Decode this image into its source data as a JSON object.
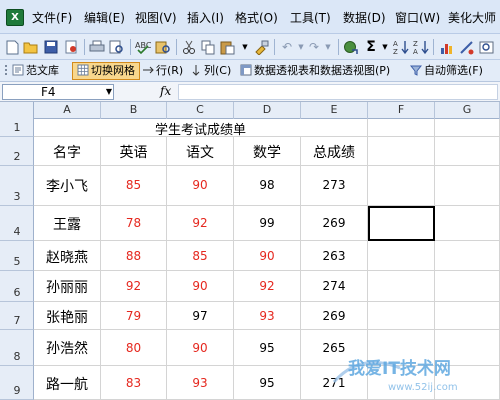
{
  "menubar": {
    "items": [
      "文件(F)",
      "编辑(E)",
      "视图(V)",
      "插入(I)",
      "格式(O)",
      "工具(T)",
      "数据(D)",
      "窗口(W)",
      "美化大师"
    ]
  },
  "toolbar1": {
    "icons": [
      "new-icon",
      "open-icon",
      "save-icon",
      "permission-icon",
      "print-icon",
      "print-preview-icon",
      "spell-check-icon",
      "research-icon",
      "cut-icon",
      "copy-icon",
      "paste-icon",
      "format-painter-icon",
      "undo-icon",
      "redo-icon",
      "hyperlink-icon",
      "autosum-icon",
      "sort-ascending-icon",
      "chart-icon"
    ],
    "sigma": "Σ"
  },
  "toolbar2": {
    "fanwenku": "范文库",
    "switch_grid": "切换网格",
    "row": "行(R)",
    "col": "列(C)",
    "pivot": "数据透视表和数据透视图(P)",
    "autofilter": "自动筛选(F)"
  },
  "formulabar": {
    "namebox": "F4",
    "fx": "fx",
    "formula": ""
  },
  "columns": [
    "A",
    "B",
    "C",
    "D",
    "E",
    "F",
    "G"
  ],
  "rows": [
    "1",
    "2",
    "3",
    "4",
    "5",
    "6",
    "7",
    "8",
    "9"
  ],
  "sheet": {
    "title": "学生考试成绩单",
    "headers": [
      "名字",
      "英语",
      "语文",
      "数学",
      "总成绩"
    ],
    "records": [
      {
        "name": "李小飞",
        "english": "85",
        "chinese": "90",
        "math": "98",
        "total": "273"
      },
      {
        "name": "王露",
        "english": "78",
        "chinese": "92",
        "math": "99",
        "total": "269"
      },
      {
        "name": "赵晓燕",
        "english": "88",
        "chinese": "85",
        "math": "90",
        "total": "263"
      },
      {
        "name": "孙丽丽",
        "english": "92",
        "chinese": "90",
        "math": "92",
        "total": "274"
      },
      {
        "name": "张艳丽",
        "english": "79",
        "chinese": "97",
        "math": "93",
        "total": "269"
      },
      {
        "name": "孙浩然",
        "english": "80",
        "chinese": "90",
        "math": "95",
        "total": "265"
      },
      {
        "name": "路一航",
        "english": "83",
        "chinese": "93",
        "math": "95",
        "total": "271"
      }
    ]
  },
  "colors": {
    "highlight_red": "#e5271e",
    "menubar_bg": "#dbe7f7",
    "header_bg": "#e6edf7",
    "active_button": "#f8d78d"
  },
  "watermark": {
    "text": "我爱IT技术网",
    "url": "www.52ij.com"
  }
}
